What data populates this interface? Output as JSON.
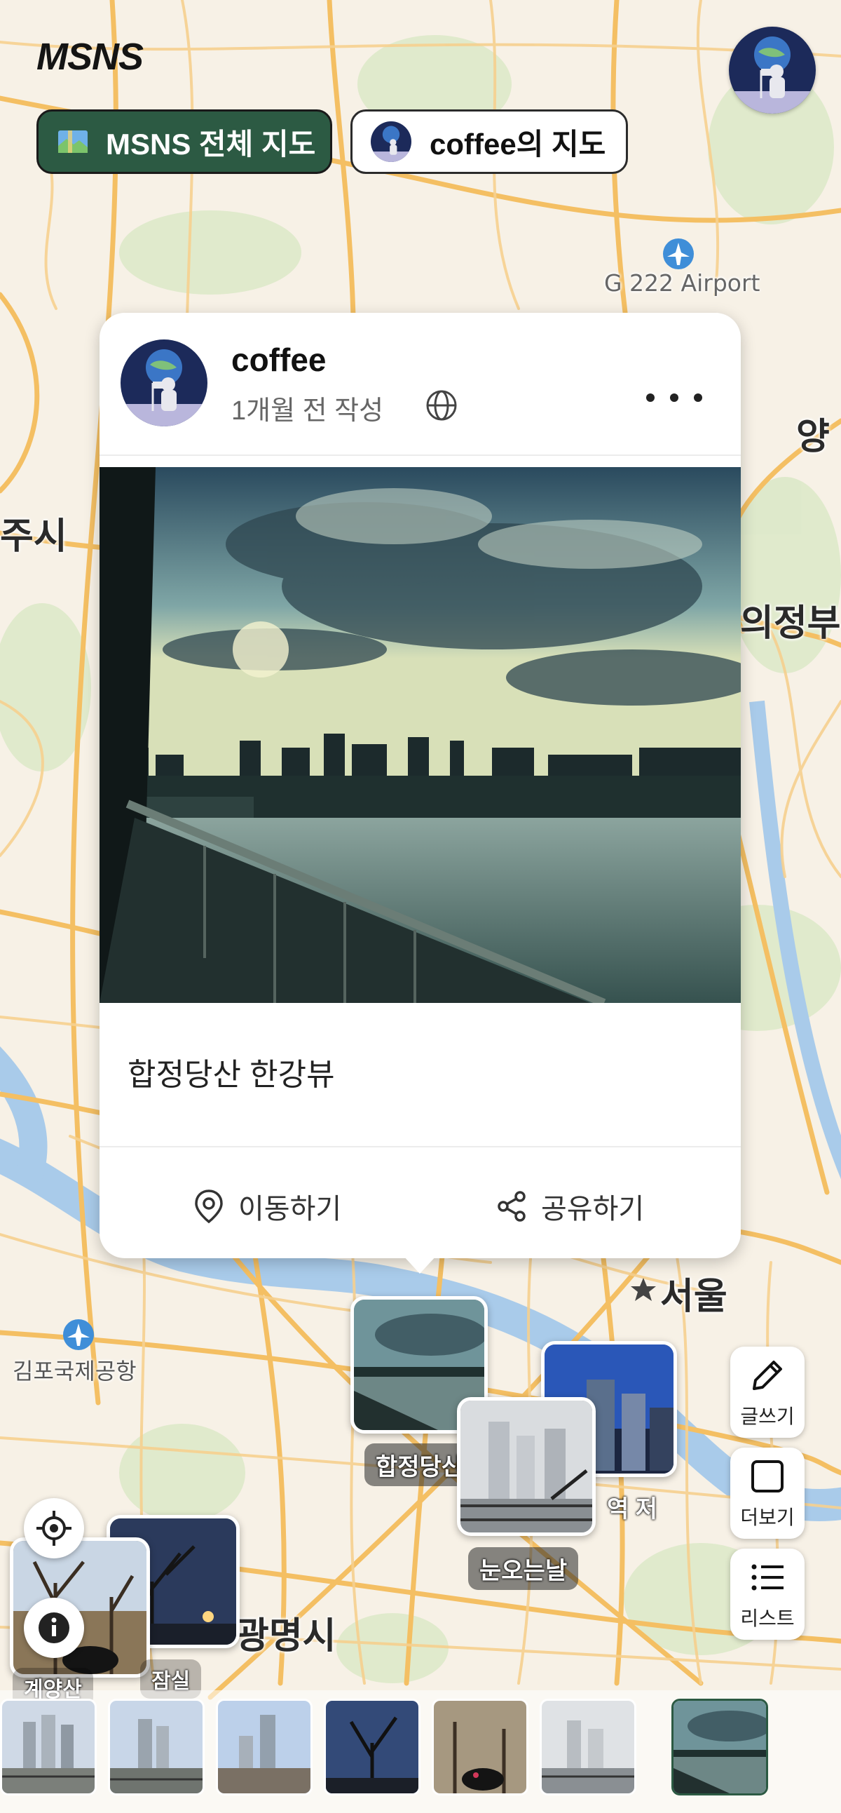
{
  "app": {
    "logo": "MSNS",
    "avatar_icon": "astronaut-avatar-icon"
  },
  "chips": {
    "all_map": {
      "label": "MSNS 전체 지도",
      "icon": "map-icon",
      "bg": "#2c5a43"
    },
    "my_map": {
      "label": "coffee의 지도"
    }
  },
  "map": {
    "labels": {
      "airport": "G 222 Airport",
      "yang": "양",
      "ju_si": "주시",
      "uijeongbu": "의정부",
      "seoul": "서울",
      "gimpo": "김포국제공항",
      "gwangmyeong": "광명시"
    },
    "colors": {
      "land": "#f7f1e6",
      "road": "#f5c26b",
      "water": "#a9cbea",
      "green": "#d8e8c4"
    }
  },
  "post": {
    "username": "coffee",
    "time": "1개월 전 작성",
    "visibility_icon": "globe-icon",
    "text": "합정당산 한강뷰",
    "actions": {
      "move": "이동하기",
      "share": "공유하기"
    }
  },
  "markers": {
    "hapjeong": "합정당산",
    "snow": "눈오는날",
    "station": "역 저"
  },
  "sidebar": {
    "write": "글쓰기",
    "more": "더보기",
    "list": "리스트"
  },
  "cluster": {
    "labels": [
      "계양산",
      "잠실"
    ]
  }
}
